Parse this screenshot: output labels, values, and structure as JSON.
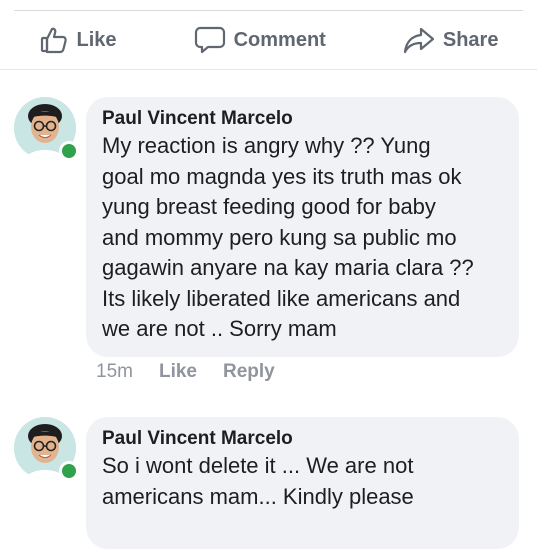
{
  "actions": {
    "like_label": "Like",
    "comment_label": "Comment",
    "share_label": "Share"
  },
  "comments": [
    {
      "author": "Paul Vincent Marcelo",
      "text": "My reaction is angry why ?? Yung\ngoal mo magnda yes its truth mas ok\nyung breast feeding good for baby\nand mommy pero kung sa public mo\ngagawin anyare na kay maria clara ??\nIts likely liberated like americans and\nwe are not .. Sorry mam",
      "time": "15m",
      "like_label": "Like",
      "reply_label": "Reply",
      "online": true
    },
    {
      "author": "Paul Vincent Marcelo",
      "text": "So i wont delete it ... We are not\namericans mam... Kindly please",
      "online": true
    }
  ],
  "colors": {
    "bubble": "#f0f2f5",
    "meta_text": "#90949c",
    "action_text": "#606770",
    "presence": "#31a24c"
  }
}
